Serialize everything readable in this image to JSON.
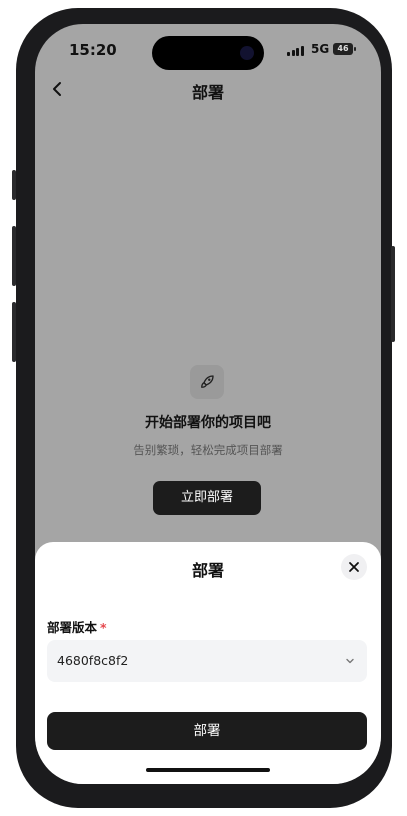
{
  "status_bar": {
    "time": "15:20",
    "network": "5G",
    "battery": "46"
  },
  "nav": {
    "title": "部署"
  },
  "empty_state": {
    "icon": "rocket-icon",
    "title": "开始部署你的项目吧",
    "subtitle": "告别繁琐，轻松完成项目部署",
    "button_label": "立即部署"
  },
  "sheet": {
    "title": "部署",
    "field_label": "部署版本",
    "required_mark": "*",
    "select_value": "4680f8c8f2",
    "submit_label": "部署"
  },
  "colors": {
    "overlay_bg": "#a5a5a5",
    "primary_button": "#1c1c1c",
    "required": "#e5484d",
    "field_bg": "#f3f4f6"
  }
}
